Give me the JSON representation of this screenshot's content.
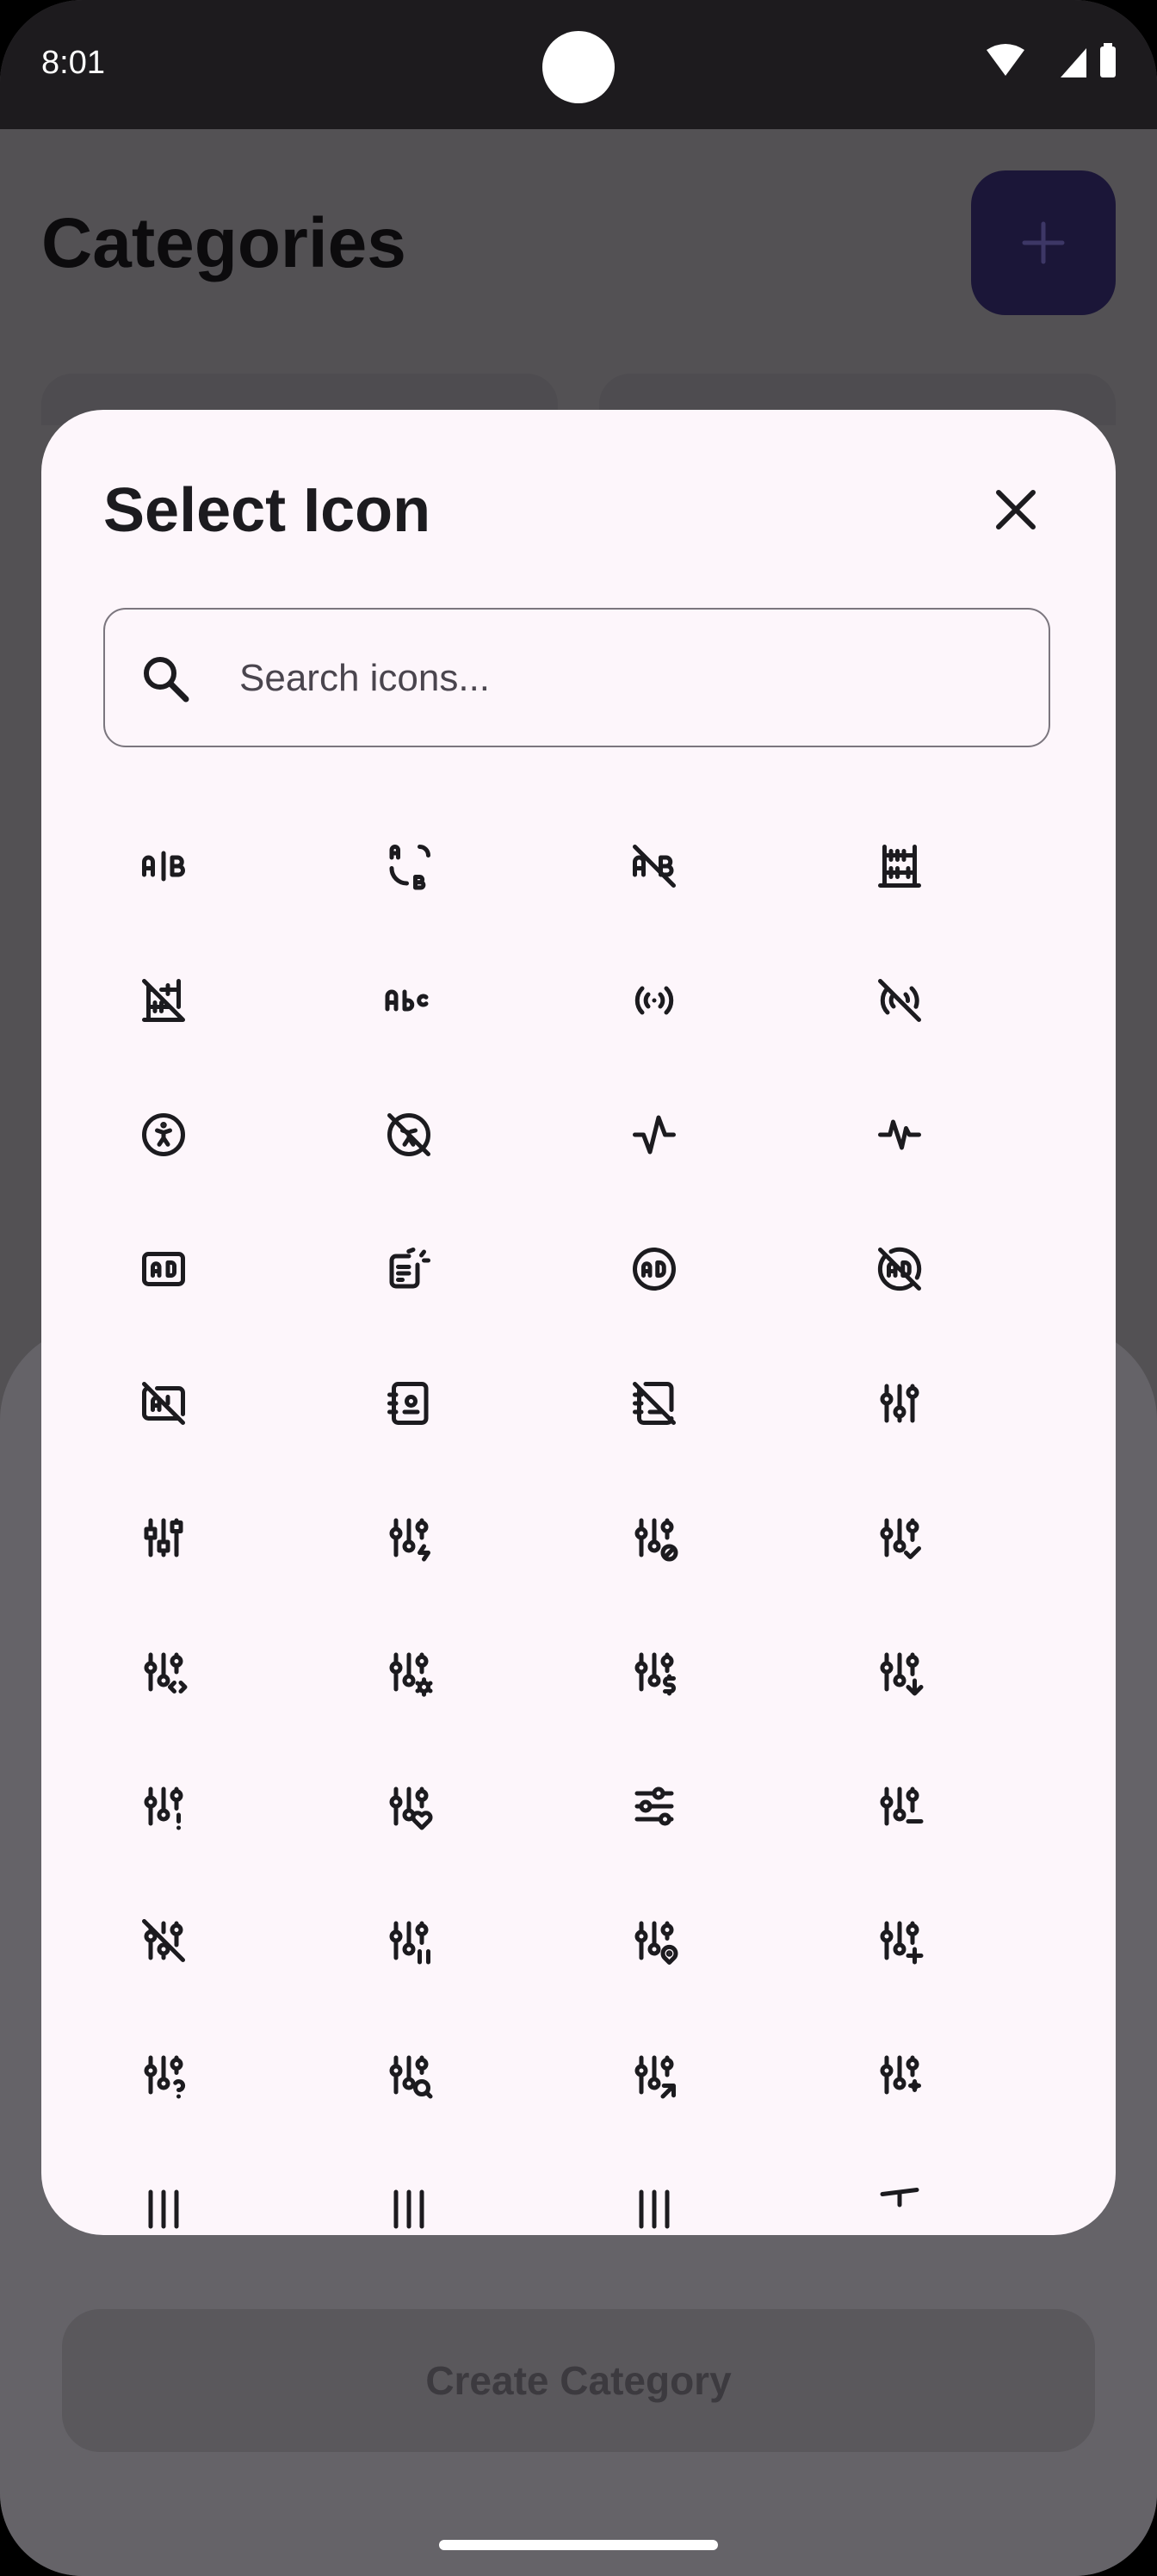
{
  "status_bar": {
    "time": "8:01"
  },
  "screen": {
    "title": "Categories",
    "create_label": "Create Category"
  },
  "dialog": {
    "title": "Select Icon",
    "search_placeholder": "Search icons..."
  },
  "icons": [
    "ab-testing-icon",
    "ab-swap-icon",
    "ab-off-icon",
    "abacus-icon",
    "abacus-off-icon",
    "abc-icon",
    "access-point-icon",
    "access-point-off-icon",
    "accessible-icon",
    "accessible-off-icon",
    "activity-icon",
    "activity-heartbeat-icon",
    "ad-icon",
    "ad-2-icon",
    "ad-circle-icon",
    "ad-circle-off-icon",
    "ad-off-icon",
    "address-book-icon",
    "address-book-off-icon",
    "adjustments-icon",
    "adjustments-alt-icon",
    "adjustments-bolt-icon",
    "adjustments-cancel-icon",
    "adjustments-check-icon",
    "adjustments-code-icon",
    "adjustments-cog-icon",
    "adjustments-dollar-icon",
    "adjustments-down-icon",
    "adjustments-exclamation-icon",
    "adjustments-heart-icon",
    "adjustments-horizontal-icon",
    "adjustments-minus-icon",
    "adjustments-off-icon",
    "adjustments-pause-icon",
    "adjustments-pin-icon",
    "adjustments-plus-icon",
    "adjustments-question-icon",
    "adjustments-search-icon",
    "adjustments-share-icon",
    "adjustments-spark-icon",
    "adjustments-star-icon",
    "adjustments-up-icon",
    "adjustments-x-icon",
    "aerial-lift-icon"
  ],
  "colors": {
    "accent_dark": "#1b1638",
    "dialog_bg": "#fdf6fb",
    "scrim": "#535154"
  }
}
